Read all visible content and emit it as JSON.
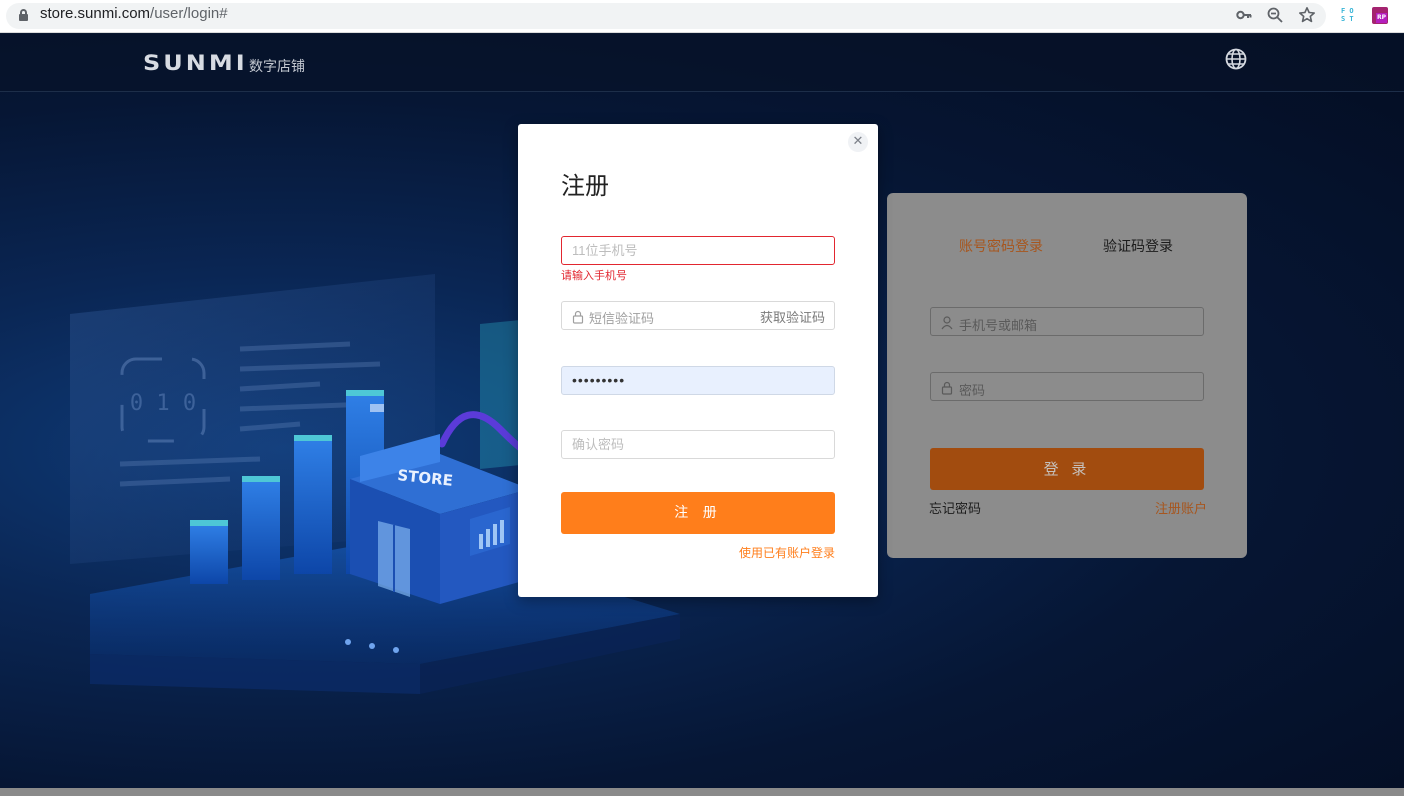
{
  "browser": {
    "url_host": "store.sunmi.com",
    "url_path": "/user/login#"
  },
  "header": {
    "logo_text": "SUNMI",
    "logo_subtitle": "数字店铺"
  },
  "illustration": {
    "store_sign": "STORE",
    "badge_text": "0 1 0"
  },
  "login_card": {
    "tab_account": "账号密码登录",
    "tab_code": "验证码登录",
    "account_placeholder": "手机号或邮箱",
    "password_placeholder": "密码",
    "login_button": "登 录",
    "forgot_password": "忘记密码",
    "register_link": "注册账户"
  },
  "register_modal": {
    "title": "注册",
    "phone_placeholder": "11位手机号",
    "phone_error": "请输入手机号",
    "sms_placeholder": "短信验证码",
    "get_code": "获取验证码",
    "password_value": "•••••••••",
    "confirm_placeholder": "确认密码",
    "submit_button": "注 册",
    "existing_account_link": "使用已有账户登录"
  },
  "colors": {
    "accent": "#ff7e1b",
    "error": "#e2262f",
    "link_dim": "#a7561e"
  }
}
